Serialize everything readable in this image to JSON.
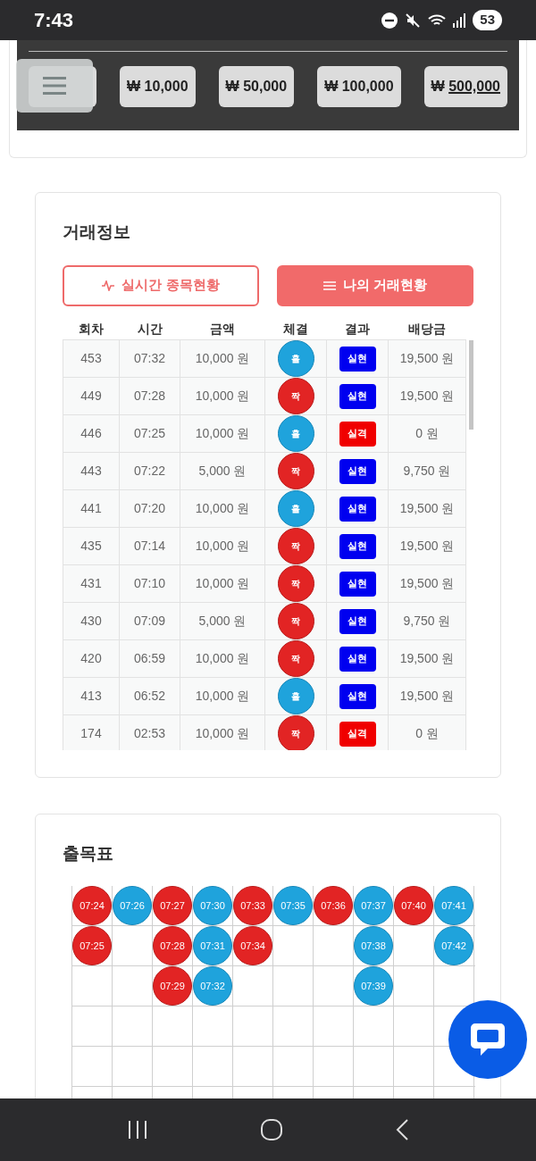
{
  "status_bar": {
    "time": "7:43",
    "battery": "53"
  },
  "amount_chips": [
    {
      "currency": "₩",
      "amount": "10,000",
      "selected": false
    },
    {
      "currency": "₩",
      "amount": "50,000",
      "selected": false
    },
    {
      "currency": "₩",
      "amount": "100,000",
      "selected": false
    },
    {
      "currency": "₩",
      "amount": "500,000",
      "selected": true
    }
  ],
  "trade_info": {
    "title": "거래정보",
    "tabs": [
      {
        "label": "실시간 종목현황",
        "kind": "pulse",
        "selected": false
      },
      {
        "label": "나의 거래현황",
        "kind": "list",
        "selected": true
      }
    ],
    "columns": [
      "회차",
      "시간",
      "금액",
      "체결",
      "결과",
      "배당금"
    ],
    "rows": [
      {
        "round": "453",
        "time": "07:32",
        "amount": "10,000 원",
        "side": {
          "label": "홀",
          "kind": "odd"
        },
        "result": {
          "label": "실현",
          "kind": "win"
        },
        "payout": "19,500 원"
      },
      {
        "round": "449",
        "time": "07:28",
        "amount": "10,000 원",
        "side": {
          "label": "짝",
          "kind": "even"
        },
        "result": {
          "label": "실현",
          "kind": "win"
        },
        "payout": "19,500 원"
      },
      {
        "round": "446",
        "time": "07:25",
        "amount": "10,000 원",
        "side": {
          "label": "홀",
          "kind": "odd"
        },
        "result": {
          "label": "실격",
          "kind": "loss"
        },
        "payout": "0 원"
      },
      {
        "round": "443",
        "time": "07:22",
        "amount": "5,000 원",
        "side": {
          "label": "짝",
          "kind": "even"
        },
        "result": {
          "label": "실현",
          "kind": "win"
        },
        "payout": "9,750 원"
      },
      {
        "round": "441",
        "time": "07:20",
        "amount": "10,000 원",
        "side": {
          "label": "홀",
          "kind": "odd"
        },
        "result": {
          "label": "실현",
          "kind": "win"
        },
        "payout": "19,500 원"
      },
      {
        "round": "435",
        "time": "07:14",
        "amount": "10,000 원",
        "side": {
          "label": "짝",
          "kind": "even"
        },
        "result": {
          "label": "실현",
          "kind": "win"
        },
        "payout": "19,500 원"
      },
      {
        "round": "431",
        "time": "07:10",
        "amount": "10,000 원",
        "side": {
          "label": "짝",
          "kind": "even"
        },
        "result": {
          "label": "실현",
          "kind": "win"
        },
        "payout": "19,500 원"
      },
      {
        "round": "430",
        "time": "07:09",
        "amount": "5,000 원",
        "side": {
          "label": "짝",
          "kind": "even"
        },
        "result": {
          "label": "실현",
          "kind": "win"
        },
        "payout": "9,750 원"
      },
      {
        "round": "420",
        "time": "06:59",
        "amount": "10,000 원",
        "side": {
          "label": "짝",
          "kind": "even"
        },
        "result": {
          "label": "실현",
          "kind": "win"
        },
        "payout": "19,500 원"
      },
      {
        "round": "413",
        "time": "06:52",
        "amount": "10,000 원",
        "side": {
          "label": "홀",
          "kind": "odd"
        },
        "result": {
          "label": "실현",
          "kind": "win"
        },
        "payout": "19,500 원"
      },
      {
        "round": "174",
        "time": "02:53",
        "amount": "10,000 원",
        "side": {
          "label": "짝",
          "kind": "even"
        },
        "result": {
          "label": "실격",
          "kind": "loss"
        },
        "payout": "0 원"
      }
    ]
  },
  "bead_board": {
    "title": "출목표",
    "columns": [
      {
        "kind": "even",
        "times": [
          "07:24",
          "07:25"
        ]
      },
      {
        "kind": "odd",
        "times": [
          "07:26"
        ]
      },
      {
        "kind": "even",
        "times": [
          "07:27",
          "07:28",
          "07:29"
        ]
      },
      {
        "kind": "odd",
        "times": [
          "07:30",
          "07:31",
          "07:32"
        ]
      },
      {
        "kind": "even",
        "times": [
          "07:33",
          "07:34"
        ]
      },
      {
        "kind": "odd",
        "times": [
          "07:35"
        ]
      },
      {
        "kind": "even",
        "times": [
          "07:36"
        ]
      },
      {
        "kind": "odd",
        "times": [
          "07:37",
          "07:38",
          "07:39"
        ]
      },
      {
        "kind": "even",
        "times": [
          "07:40"
        ]
      },
      {
        "kind": "odd",
        "times": [
          "07:41",
          "07:42"
        ]
      }
    ]
  }
}
